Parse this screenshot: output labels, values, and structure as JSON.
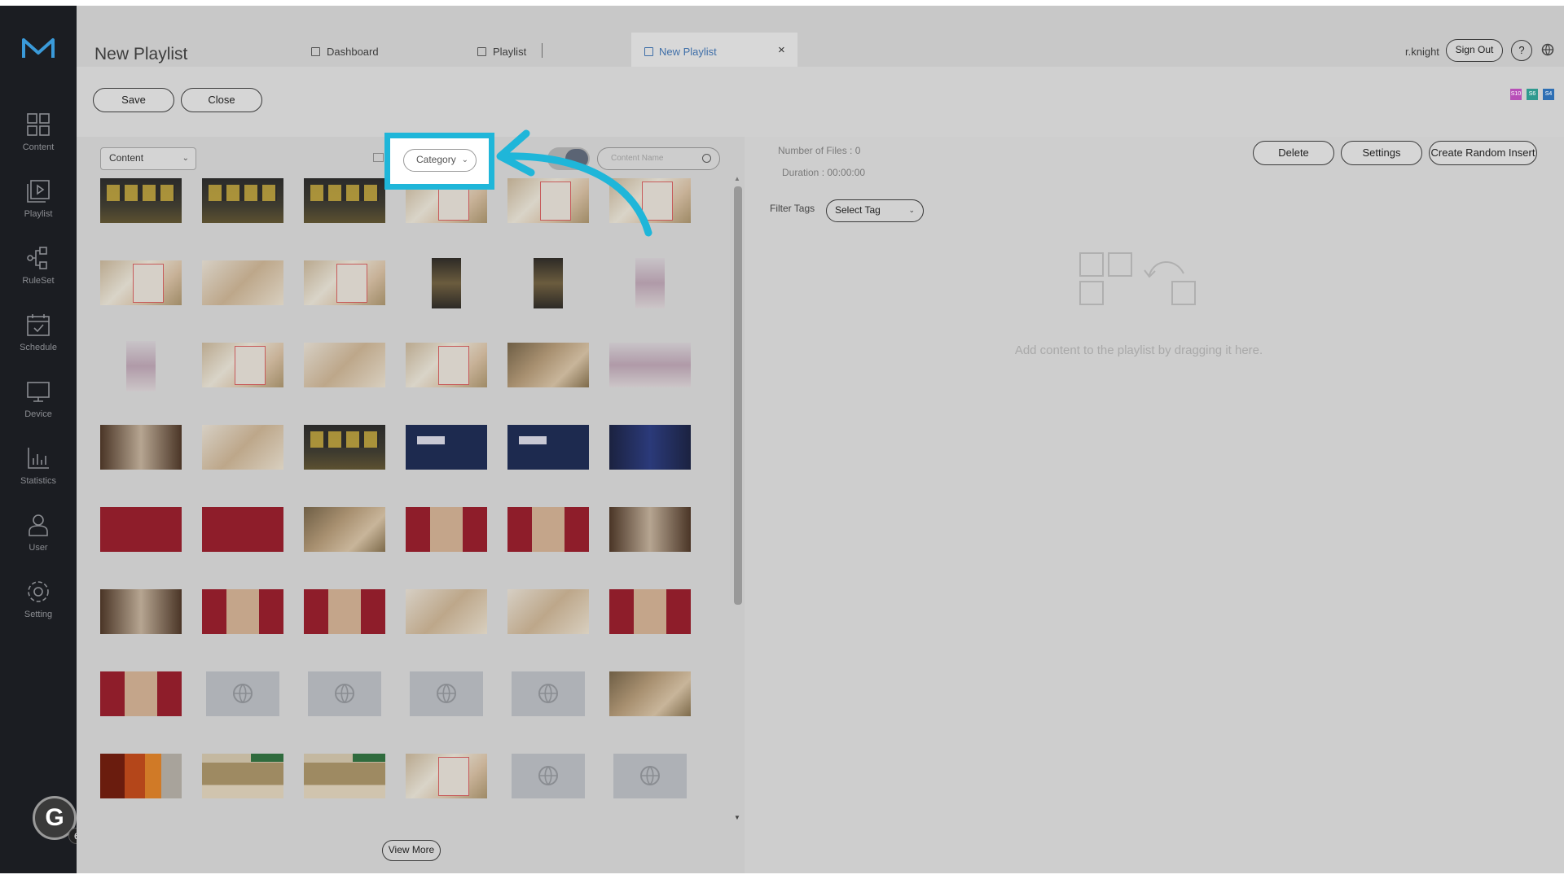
{
  "sidebar": {
    "items": [
      {
        "label": "Content",
        "icon": "content-grid-icon"
      },
      {
        "label": "Playlist",
        "icon": "playlist-icon"
      },
      {
        "label": "RuleSet",
        "icon": "ruleset-icon"
      },
      {
        "label": "Schedule",
        "icon": "schedule-icon"
      },
      {
        "label": "Device",
        "icon": "device-icon"
      },
      {
        "label": "Statistics",
        "icon": "statistics-icon"
      },
      {
        "label": "User",
        "icon": "user-icon"
      },
      {
        "label": "Setting",
        "icon": "gear-icon"
      }
    ],
    "avatar_letter": "G",
    "avatar_badge": "6"
  },
  "header": {
    "page_title": "New Playlist",
    "tabs": [
      {
        "label": "Dashboard"
      },
      {
        "label": "Playlist"
      },
      {
        "label": "New Playlist",
        "active": true
      }
    ],
    "close_tab": "×",
    "username": "r.knight",
    "signout_label": "Sign Out",
    "help_label": "?"
  },
  "toolbar": {
    "save_label": "Save",
    "close_label": "Close",
    "badges": [
      {
        "text": "S10",
        "color": "#b84fb8"
      },
      {
        "text": "S6",
        "color": "#2f9a8f"
      },
      {
        "text": "S4",
        "color": "#2e6fb4"
      }
    ]
  },
  "library": {
    "type_select": "Content",
    "category_select": "Category",
    "search_placeholder": "Content Name",
    "view_more_label": "View More",
    "chevron": "⌄",
    "scroll_up": "▲",
    "scroll_down": "▼"
  },
  "playlist_panel": {
    "number_of_files": "Number of Files : 0",
    "duration": "Duration : 00:00:00",
    "delete_label": "Delete",
    "settings_label": "Settings",
    "random_insert_label": "Create Random Insert",
    "filter_tags_label": "Filter Tags",
    "select_tag": "Select Tag",
    "empty_text": "Add content to the playlist by dragging it here."
  },
  "colors": {
    "highlight": "#1fb6d9",
    "active_tab": "#3f6fa8"
  }
}
